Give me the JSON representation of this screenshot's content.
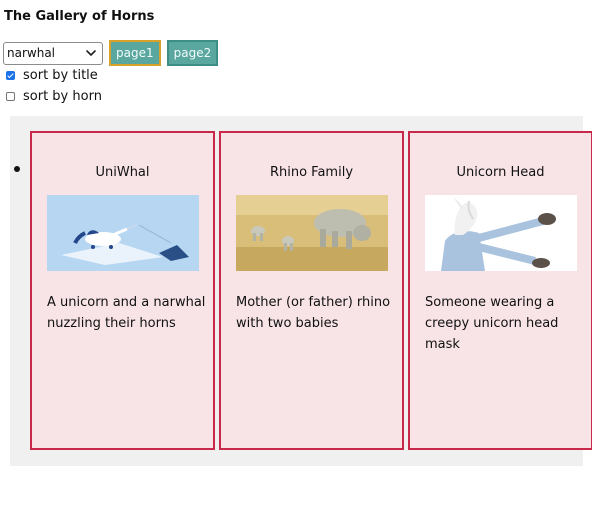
{
  "header": {
    "title": "The Gallery of Horns"
  },
  "controls": {
    "select": {
      "value": "narwhal",
      "icon": "chevron-down-icon"
    },
    "buttons": [
      {
        "label": "page1",
        "active": true
      },
      {
        "label": "page2",
        "active": false
      }
    ],
    "sort_title": {
      "label": "sort by title",
      "checked": true
    },
    "sort_horn": {
      "label": "sort by horn",
      "checked": false
    }
  },
  "colors": {
    "button": "#5aa7a0",
    "active_button_border": "#d7a12a",
    "card_border": "#c8284a",
    "card_background": "#f8e4e7",
    "gallery_background": "#f0f0f0"
  },
  "gallery": {
    "cards": [
      {
        "title": "UniWhal",
        "image": "unicorn-narwhal-illustration",
        "description": "A unicorn and a narwhal nuzzling their horns"
      },
      {
        "title": "Rhino Family",
        "image": "rhino-family-photo",
        "description": "Mother (or father) rhino with two babies"
      },
      {
        "title": "Unicorn Head",
        "image": "unicorn-head-mask-photo",
        "description": "Someone wearing a creepy unicorn head mask"
      }
    ]
  }
}
